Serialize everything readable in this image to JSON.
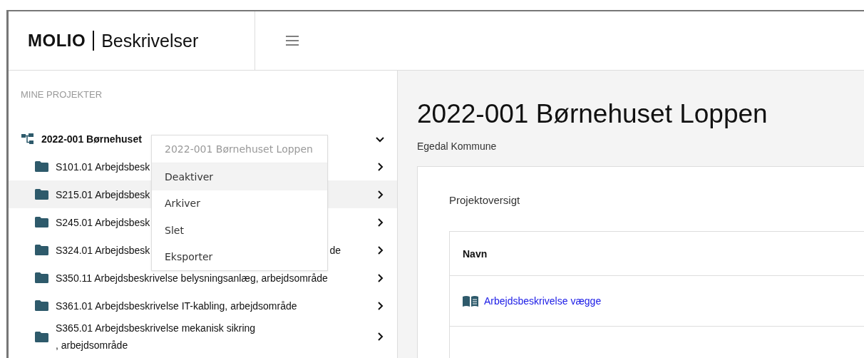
{
  "header": {
    "logo": "MOLIO",
    "product": "Beskrivelser"
  },
  "sidebar": {
    "heading": "MINE PROJEKTER",
    "project": {
      "label": "2022-001 Børnehuset",
      "expanded": true
    },
    "items": [
      {
        "label": "S101.01 Arbejdsbesk",
        "selected": false
      },
      {
        "label": "S215.01 Arbejdsbesk",
        "selected": true
      },
      {
        "label": "S245.01 Arbejdsbesk",
        "selected": false
      },
      {
        "label": "S324.01 Arbejdsbesk",
        "tail": "de",
        "selected": false
      },
      {
        "label": "S350.11 Arbejdsbeskrivelse belysningsanlæg, arbejdsområde",
        "selected": false
      },
      {
        "label": "S361.01 Arbejdsbeskrivelse IT-kabling, arbejdsområde",
        "selected": false
      },
      {
        "label": "S365.01 Arbejdsbeskrivelse mekanisk sikring\n, arbejdsområde",
        "selected": false
      }
    ]
  },
  "context_menu": {
    "title": "2022-001 Børnehuset Loppen",
    "items": [
      {
        "label": "Deaktiver",
        "selected": true
      },
      {
        "label": "Arkiver",
        "selected": false
      },
      {
        "label": "Slet",
        "selected": false
      },
      {
        "label": "Eksporter",
        "selected": false
      }
    ]
  },
  "main": {
    "title": "2022-001 Børnehuset Loppen",
    "subtitle": "Egedal Kommune",
    "card": {
      "title": "Projektoversigt",
      "table": {
        "columns": [
          "Navn"
        ],
        "rows": [
          {
            "name": "Arbejdsbeskrivelse vægge"
          }
        ]
      }
    }
  }
}
